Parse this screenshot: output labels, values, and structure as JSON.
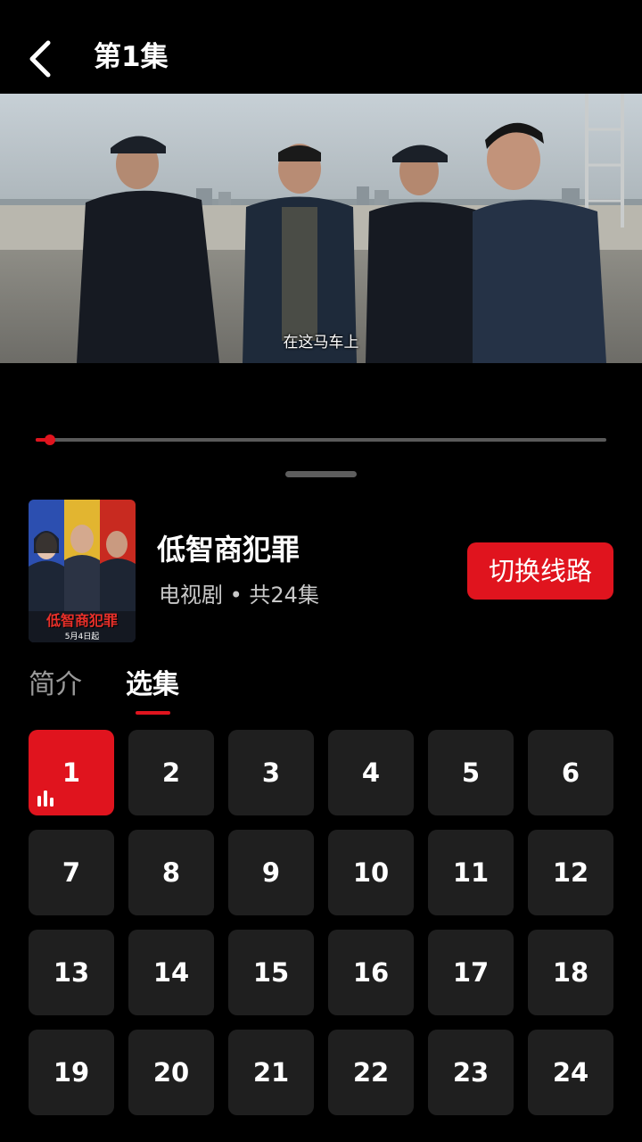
{
  "header": {
    "title": "第1集",
    "back_icon": "chevron-left-icon"
  },
  "video": {
    "subtitle": "在这马车上",
    "progress_fraction": 0.025
  },
  "show": {
    "title": "低智商犯罪",
    "meta": "电视剧 • 共24集",
    "poster_title": "低智商犯罪",
    "poster_date": "5月4日起",
    "switch_label": "切换线路"
  },
  "tabs": [
    {
      "label": "简介",
      "active": false
    },
    {
      "label": "选集",
      "active": true
    }
  ],
  "episodes": {
    "current": 1,
    "items": [
      "1",
      "2",
      "3",
      "4",
      "5",
      "6",
      "7",
      "8",
      "9",
      "10",
      "11",
      "12",
      "13",
      "14",
      "15",
      "16",
      "17",
      "18",
      "19",
      "20",
      "21",
      "22",
      "23",
      "24"
    ]
  },
  "colors": {
    "accent": "#e0141e",
    "tile": "#1f1f1f",
    "background": "#000000"
  }
}
